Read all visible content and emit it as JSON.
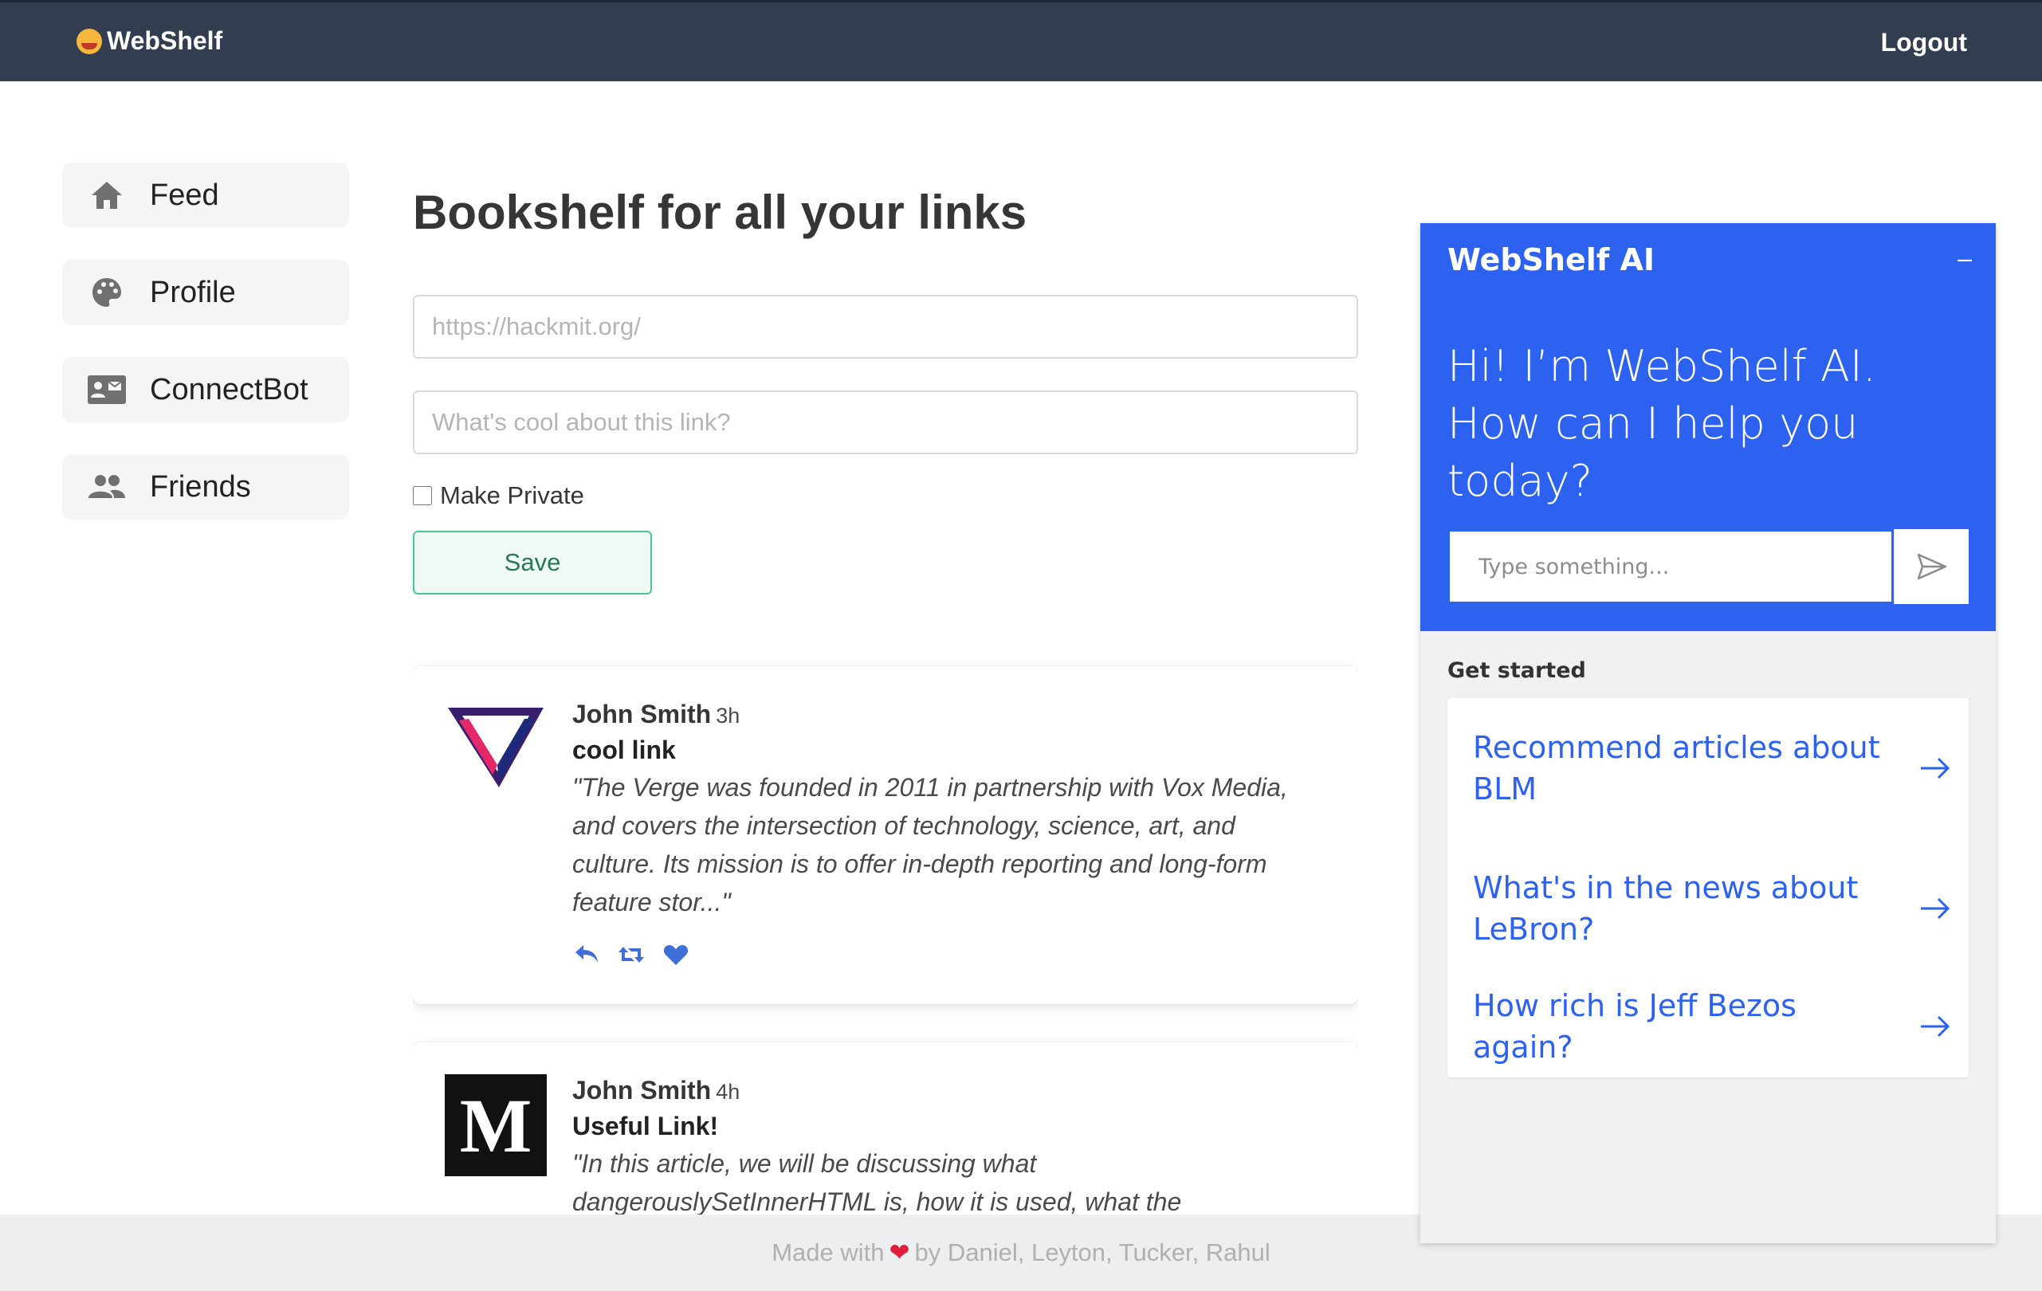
{
  "navbar": {
    "brand": "WebShelf",
    "logout": "Logout"
  },
  "sidebar": {
    "items": [
      {
        "label": "Feed",
        "icon": "home-icon"
      },
      {
        "label": "Profile",
        "icon": "palette-icon"
      },
      {
        "label": "ConnectBot",
        "icon": "id-card-icon"
      },
      {
        "label": "Friends",
        "icon": "users-icon"
      }
    ]
  },
  "main": {
    "title": "Bookshelf for all your links",
    "url_placeholder": "https://hackmit.org/",
    "desc_placeholder": "What's cool about this link?",
    "private_label": "Make Private",
    "save_label": "Save"
  },
  "posts": [
    {
      "author": "John Smith",
      "time": "3h",
      "title": "cool link",
      "quote": "\"The Verge was founded in 2011 in partnership with Vox Media, and covers the intersection of technology, science, art, and culture. Its mission is to offer in-depth reporting and long-form feature stor...\"",
      "thumb": "verge-logo"
    },
    {
      "author": "John Smith",
      "time": "4h",
      "title": "Useful Link!",
      "quote": "\"In this article, we will be discussing what dangerouslySetInnerHTML is, how it is used, what the",
      "thumb": "medium-logo",
      "thumb_text": "M"
    }
  ],
  "footer": {
    "before": "Made with",
    "after": "by Daniel, Leyton, Tucker, Rahul"
  },
  "ai": {
    "title": "WebShelf AI",
    "minimize": "–",
    "greeting": "Hi! I’m WebShelf AI. How can I help you today?",
    "input_placeholder": "Type something...",
    "get_started": "Get started",
    "suggestions": [
      "Recommend articles about BLM",
      "What's in the news about LeBron?",
      "How rich is Jeff Bezos again?"
    ]
  },
  "colors": {
    "navbar": "#323d4f",
    "ai_blue": "#2d62f0",
    "save_border": "#48c78e",
    "action_blue": "#3e6fd8"
  }
}
